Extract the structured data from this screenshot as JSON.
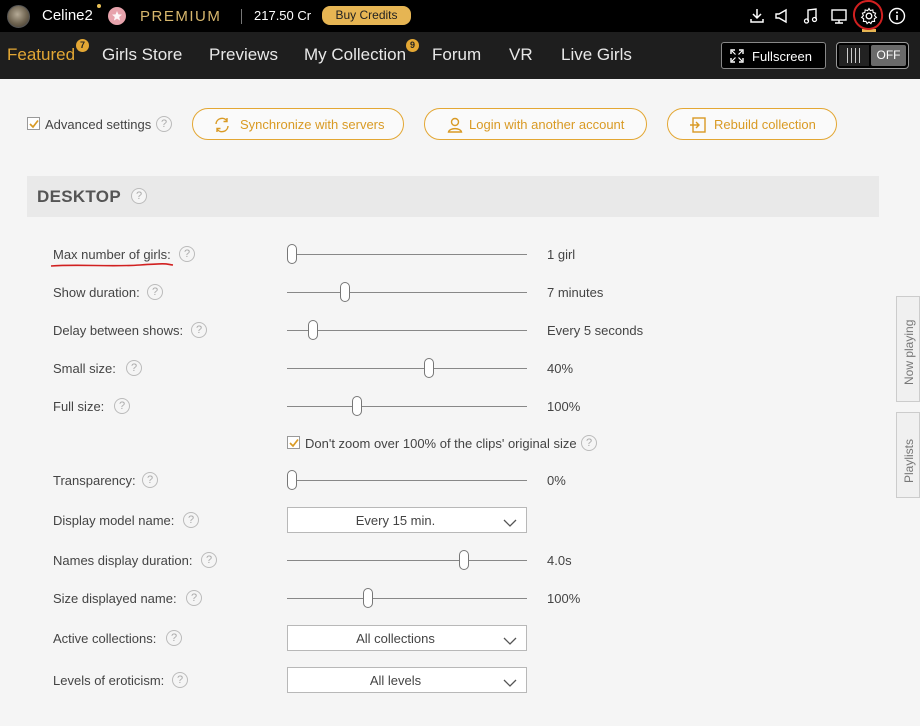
{
  "topbar": {
    "username": "Celine2",
    "premium_label": "PREMIUM",
    "credits": "217.50 Cr",
    "buy_credits_label": "Buy Credits",
    "icons": [
      "download-icon",
      "megaphone-icon",
      "music-icon",
      "monitor-icon",
      "gear-icon",
      "info-icon"
    ],
    "accent_color": "#e6b553"
  },
  "nav": {
    "items": [
      {
        "label": "Featured",
        "badge": "7",
        "active": true
      },
      {
        "label": "Girls Store"
      },
      {
        "label": "Previews"
      },
      {
        "label": "My Collection",
        "badge": "9"
      },
      {
        "label": "Forum"
      },
      {
        "label": "VR"
      },
      {
        "label": "Live Girls"
      }
    ],
    "fullscreen_label": "Fullscreen",
    "toggle_label": "OFF"
  },
  "actions": {
    "advanced_settings_label": "Advanced settings",
    "advanced_checked": true,
    "sync_label": "Synchronize with servers",
    "login_label": "Login with another account",
    "rebuild_label": "Rebuild collection"
  },
  "section": {
    "title": "DESKTOP"
  },
  "settings": {
    "max_girls": {
      "label": "Max number of girls:",
      "value": "1 girl",
      "level": 0.0
    },
    "show_duration": {
      "label": "Show duration:",
      "value": "7 minutes",
      "level": 0.24
    },
    "delay": {
      "label": "Delay between shows:",
      "value": "Every 5 seconds",
      "level": 0.11
    },
    "small_size": {
      "label": "Small size:",
      "value": "40%",
      "level": 0.59
    },
    "full_size": {
      "label": "Full size:",
      "value": "100%",
      "level": 0.29
    },
    "no_zoom": {
      "label": "Don't zoom over 100% of the clips' original size",
      "checked": true
    },
    "transparency": {
      "label": "Transparency:",
      "value": "0%",
      "level": 0.0
    },
    "display_name": {
      "label": "Display model name:",
      "value": "Every 15 min."
    },
    "names_duration": {
      "label": "Names display duration:",
      "value": "4.0s",
      "level": 0.74
    },
    "size_name": {
      "label": "Size displayed name:",
      "value": "100%",
      "level": 0.34
    },
    "active_collections": {
      "label": "Active collections:",
      "value": "All collections"
    },
    "eroticism": {
      "label": "Levels of eroticism:",
      "value": "All levels"
    }
  },
  "side_tabs": {
    "now_playing": "Now playing",
    "playlists": "Playlists"
  }
}
